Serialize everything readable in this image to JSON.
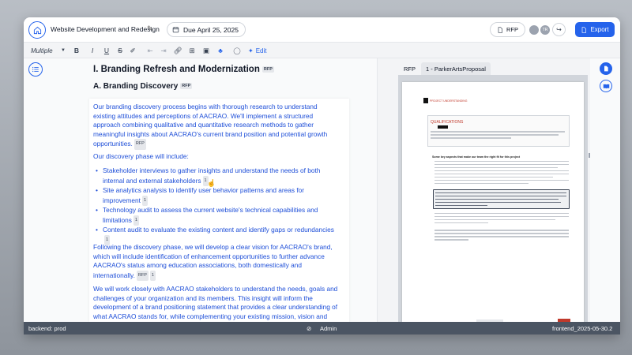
{
  "header": {
    "doc_title": "Website Development and Redesign",
    "due_label": "Due April 25, 2025",
    "rfp_label": "RFP",
    "avatars": [
      "",
      "TR"
    ],
    "export_label": "Export"
  },
  "toolbar": {
    "style_select": "Multiple",
    "edit_label": "Edit"
  },
  "editor": {
    "h1": "I. Branding Refresh and Modernization",
    "h1_tag": "RFP",
    "h2": "A. Branding Discovery",
    "h2_tag": "RFP",
    "p1": "Our branding discovery process begins with thorough research to understand existing attitudes and perceptions of AACRAO. We'll implement a structured approach combining qualitative and quantitative research methods to gather meaningful insights about AACRAO's current brand position and potential growth opportunities.",
    "p1_tag": "RFP",
    "p2": "Our discovery phase will include:",
    "bullets": [
      {
        "text": "Stakeholder interviews to gather insights and understand the needs of both internal and external stakeholders",
        "count": "1"
      },
      {
        "text": "Site analytics analysis to identify user behavior patterns and areas for improvement",
        "count": "1"
      },
      {
        "text": "Technology audit to assess the current website's technical capabilities and limitations",
        "count": "1"
      },
      {
        "text": "Content audit to evaluate the existing content and identify gaps or redundancies",
        "count": "1"
      }
    ],
    "p3": "Following the discovery phase, we will develop a clear vision for AACRAO's brand, which will include identification of enhancement opportunities to further advance AACRAO's status among education associations, both domestically and internationally.",
    "p3_tag": "RFP",
    "p3_count": "1",
    "p4": "We will work closely with AACRAO stakeholders to understand the needs, goals and challenges of your organization and its members. This insight will inform the development of a brand positioning statement that provides a clear understanding of what AACRAO stands for, while complementing your existing mission, vision and"
  },
  "right_pane": {
    "tabs": [
      "RFP",
      "1 - ParkerArtsProposal"
    ],
    "pdf": {
      "section_tag": "PROJECT UNDERSTANDING",
      "qualifications": "QUALIFICATIONS",
      "heading": "Some key aspects that make our team the right fit for this project"
    }
  },
  "footer": {
    "backend": "backend: prod",
    "admin": "Admin",
    "frontend": "frontend_2025-05-30.2"
  },
  "colors": {
    "accent": "#2563eb",
    "body_text": "#1d4ed8",
    "footer_bg": "#4b5563"
  }
}
